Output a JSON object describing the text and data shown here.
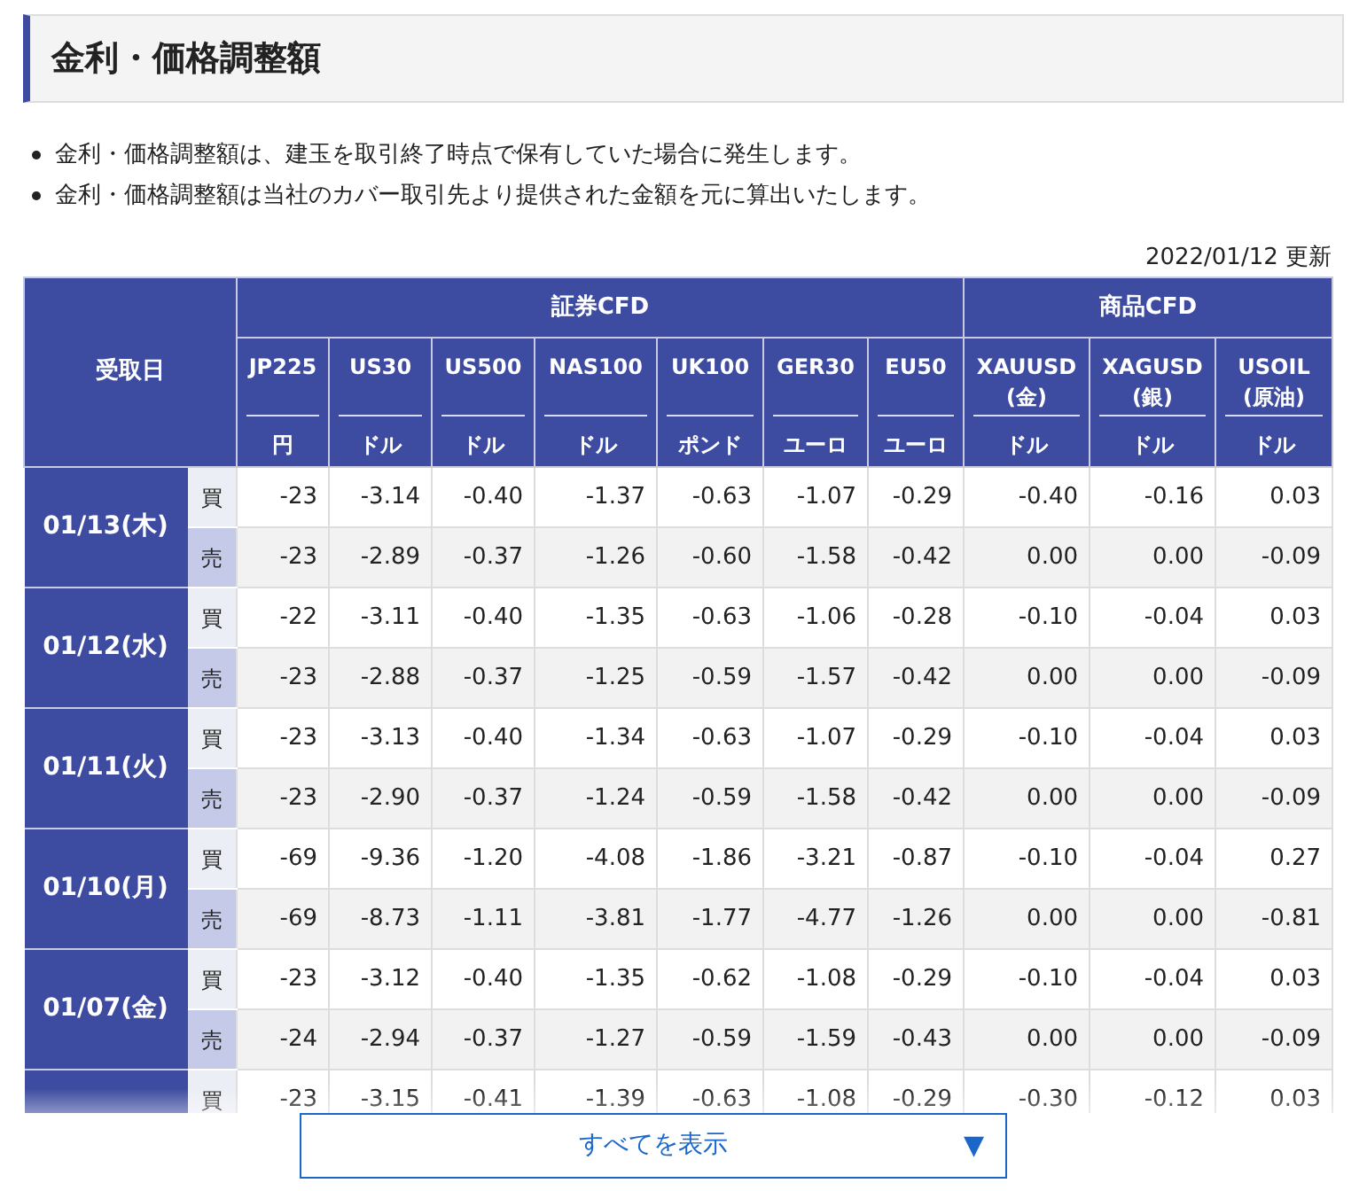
{
  "title": "金利・価格調整額",
  "notes": [
    "金利・価格調整額は、建玉を取引終了時点で保有していた場合に発生します。",
    "金利・価格調整額は当社のカバー取引先より提供された金額を元に算出いたします。"
  ],
  "updated": "2022/01/12 更新",
  "table": {
    "date_header": "受取日",
    "groups": [
      {
        "label": "証券CFD",
        "columns": [
          {
            "symbol": "JP225",
            "unit": "円"
          },
          {
            "symbol": "US30",
            "unit": "ドル"
          },
          {
            "symbol": "US500",
            "unit": "ドル"
          },
          {
            "symbol": "NAS100",
            "unit": "ドル"
          },
          {
            "symbol": "UK100",
            "unit": "ポンド"
          },
          {
            "symbol": "GER30",
            "unit": "ユーロ"
          },
          {
            "symbol": "EU50",
            "unit": "ユーロ"
          }
        ]
      },
      {
        "label": "商品CFD",
        "columns": [
          {
            "symbol": "XAUUSD",
            "sub": "(金)",
            "unit": "ドル"
          },
          {
            "symbol": "XAGUSD",
            "sub": "(銀)",
            "unit": "ドル"
          },
          {
            "symbol": "USOIL",
            "sub": "(原油)",
            "unit": "ドル"
          }
        ]
      }
    ],
    "days": [
      {
        "date": "01/13(木)",
        "rows": [
          {
            "side": "買",
            "kind": "buy",
            "values": [
              "-23",
              "-3.14",
              "-0.40",
              "-1.37",
              "-0.63",
              "-1.07",
              "-0.29",
              "-0.40",
              "-0.16",
              "0.03"
            ]
          },
          {
            "side": "売",
            "kind": "sell",
            "values": [
              "-23",
              "-2.89",
              "-0.37",
              "-1.26",
              "-0.60",
              "-1.58",
              "-0.42",
              "0.00",
              "0.00",
              "-0.09"
            ]
          }
        ]
      },
      {
        "date": "01/12(水)",
        "rows": [
          {
            "side": "買",
            "kind": "buy",
            "values": [
              "-22",
              "-3.11",
              "-0.40",
              "-1.35",
              "-0.63",
              "-1.06",
              "-0.28",
              "-0.10",
              "-0.04",
              "0.03"
            ]
          },
          {
            "side": "売",
            "kind": "sell",
            "values": [
              "-23",
              "-2.88",
              "-0.37",
              "-1.25",
              "-0.59",
              "-1.57",
              "-0.42",
              "0.00",
              "0.00",
              "-0.09"
            ]
          }
        ]
      },
      {
        "date": "01/11(火)",
        "rows": [
          {
            "side": "買",
            "kind": "buy",
            "values": [
              "-23",
              "-3.13",
              "-0.40",
              "-1.34",
              "-0.63",
              "-1.07",
              "-0.29",
              "-0.10",
              "-0.04",
              "0.03"
            ]
          },
          {
            "side": "売",
            "kind": "sell",
            "values": [
              "-23",
              "-2.90",
              "-0.37",
              "-1.24",
              "-0.59",
              "-1.58",
              "-0.42",
              "0.00",
              "0.00",
              "-0.09"
            ]
          }
        ]
      },
      {
        "date": "01/10(月)",
        "rows": [
          {
            "side": "買",
            "kind": "buy",
            "values": [
              "-69",
              "-9.36",
              "-1.20",
              "-4.08",
              "-1.86",
              "-3.21",
              "-0.87",
              "-0.10",
              "-0.04",
              "0.27"
            ]
          },
          {
            "side": "売",
            "kind": "sell",
            "values": [
              "-69",
              "-8.73",
              "-1.11",
              "-3.81",
              "-1.77",
              "-4.77",
              "-1.26",
              "0.00",
              "0.00",
              "-0.81"
            ]
          }
        ]
      },
      {
        "date": "01/07(金)",
        "rows": [
          {
            "side": "買",
            "kind": "buy",
            "values": [
              "-23",
              "-3.12",
              "-0.40",
              "-1.35",
              "-0.62",
              "-1.08",
              "-0.29",
              "-0.10",
              "-0.04",
              "0.03"
            ]
          },
          {
            "side": "売",
            "kind": "sell",
            "values": [
              "-24",
              "-2.94",
              "-0.37",
              "-1.27",
              "-0.59",
              "-1.59",
              "-0.43",
              "0.00",
              "0.00",
              "-0.09"
            ]
          }
        ]
      },
      {
        "rows": [
          {
            "side": "買",
            "kind": "buy",
            "values": [
              "-23",
              "-3.15",
              "-0.41",
              "-1.39",
              "-0.63",
              "-1.08",
              "-0.29",
              "-0.30",
              "-0.12",
              "0.03"
            ]
          }
        ]
      }
    ]
  },
  "show_all": {
    "label": "すべてを表示",
    "icon": "▼"
  }
}
